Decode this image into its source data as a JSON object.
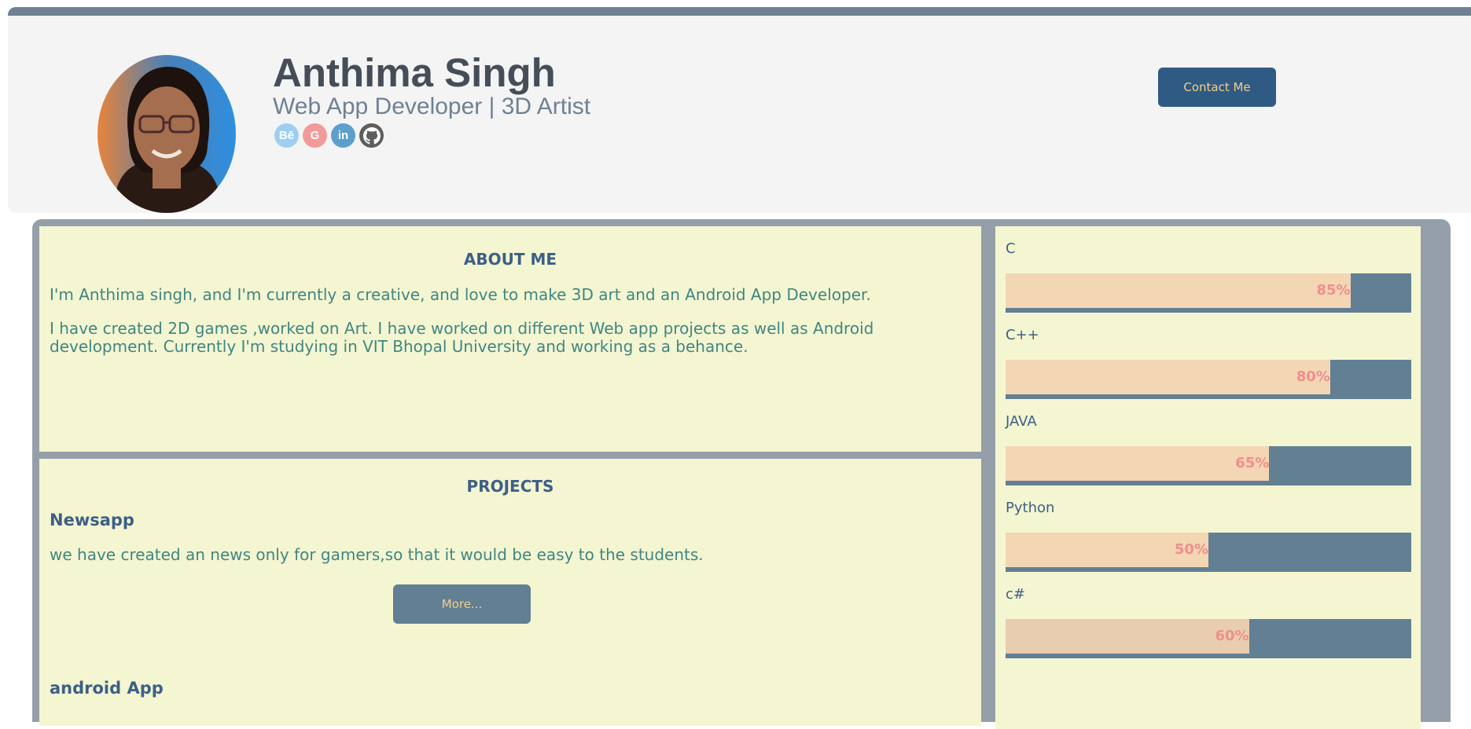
{
  "profile": {
    "name": "Anthima Singh",
    "subtitle": "Web App Developer | 3D Artist",
    "contact_label": "Contact Me"
  },
  "socials": [
    {
      "icon": "behance-icon",
      "glyph": "Bē",
      "color": "#9ecff2"
    },
    {
      "icon": "google-icon",
      "glyph": "G",
      "color": "#f29a9a"
    },
    {
      "icon": "linkedin-icon",
      "glyph": "in",
      "color": "#5c9fcc"
    },
    {
      "icon": "github-icon",
      "glyph": "",
      "color": "#5e5e5e"
    }
  ],
  "about": {
    "title": "ABOUT ME",
    "para1": "I'm Anthima singh, and I'm currently a creative, and love to make 3D art and an Android App Developer.",
    "para2": "I have created 2D games ,worked on Art. I have worked on different Web app projects as well as Android development. Currently I'm studying in VIT Bhopal University and working as a behance."
  },
  "projects": {
    "title": "PROJECTS",
    "items": [
      {
        "name": "Newsapp",
        "desc": "we have created an news only for gamers,so that it would be easy to the students.",
        "button": "More..."
      },
      {
        "name": "android App"
      }
    ]
  },
  "skills": [
    {
      "name": "C",
      "label": "85%",
      "percent": 85
    },
    {
      "name": "C++",
      "label": "80%",
      "percent": 80
    },
    {
      "name": "JAVA",
      "label": "65%",
      "percent": 65
    },
    {
      "name": "Python",
      "label": "50%",
      "percent": 50
    },
    {
      "name": "c#",
      "label": "60%",
      "percent": 60
    }
  ],
  "colors": {
    "header_bg": "#f4f4f4",
    "accent": "#2f5a84",
    "panel_bg": "#f4f6d1",
    "bar_bg": "#627f94",
    "bar_fill": "#f3d6b4",
    "percent_text": "#f08f8f"
  }
}
